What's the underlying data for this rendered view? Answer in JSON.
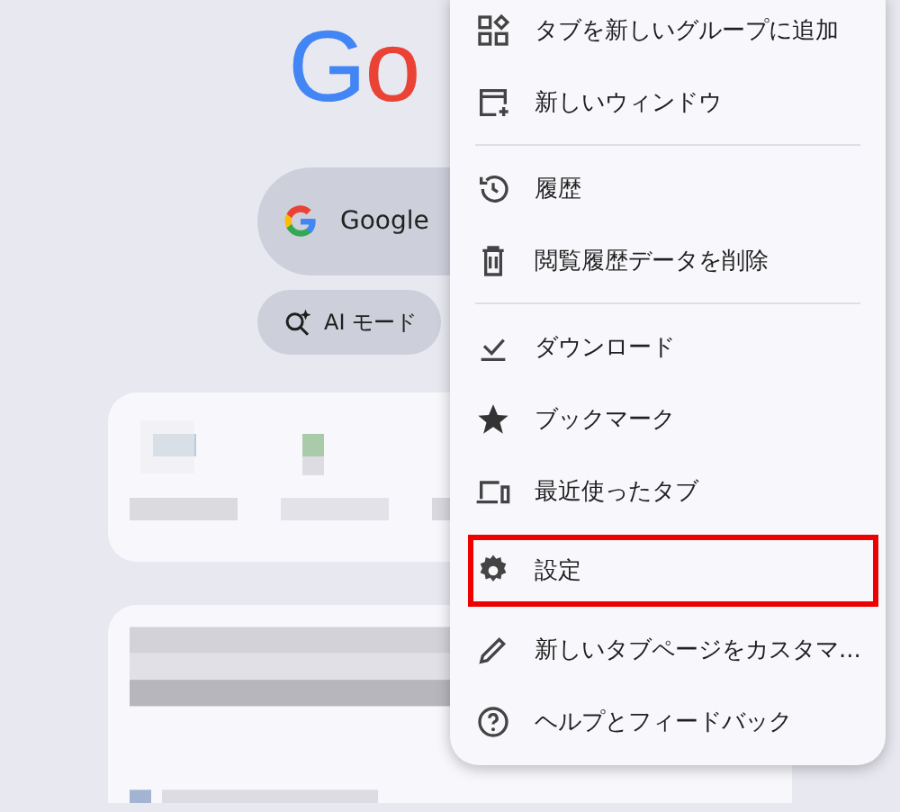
{
  "logo": {
    "letters": [
      {
        "text": "G",
        "color": "#4285f4"
      },
      {
        "text": "o",
        "color": "#ea4335"
      }
    ]
  },
  "search": {
    "placeholder": "Google"
  },
  "ai_mode": {
    "label": "AI モード"
  },
  "menu": {
    "groups": [
      [
        {
          "label": "タブを新しいグループに追加",
          "highlighted": false
        },
        {
          "label": "新しいウィンドウ",
          "highlighted": false
        }
      ],
      [
        {
          "label": "履歴",
          "highlighted": false
        },
        {
          "label": "閲覧履歴データを削除",
          "highlighted": false
        }
      ],
      [
        {
          "label": "ダウンロード",
          "highlighted": false
        },
        {
          "label": "ブックマーク",
          "highlighted": false
        },
        {
          "label": "最近使ったタブ",
          "highlighted": false
        },
        {
          "label": "設定",
          "highlighted": true
        },
        {
          "label": "新しいタブページをカスタマ...",
          "highlighted": false
        },
        {
          "label": "ヘルプとフィードバック",
          "highlighted": false
        }
      ]
    ]
  }
}
